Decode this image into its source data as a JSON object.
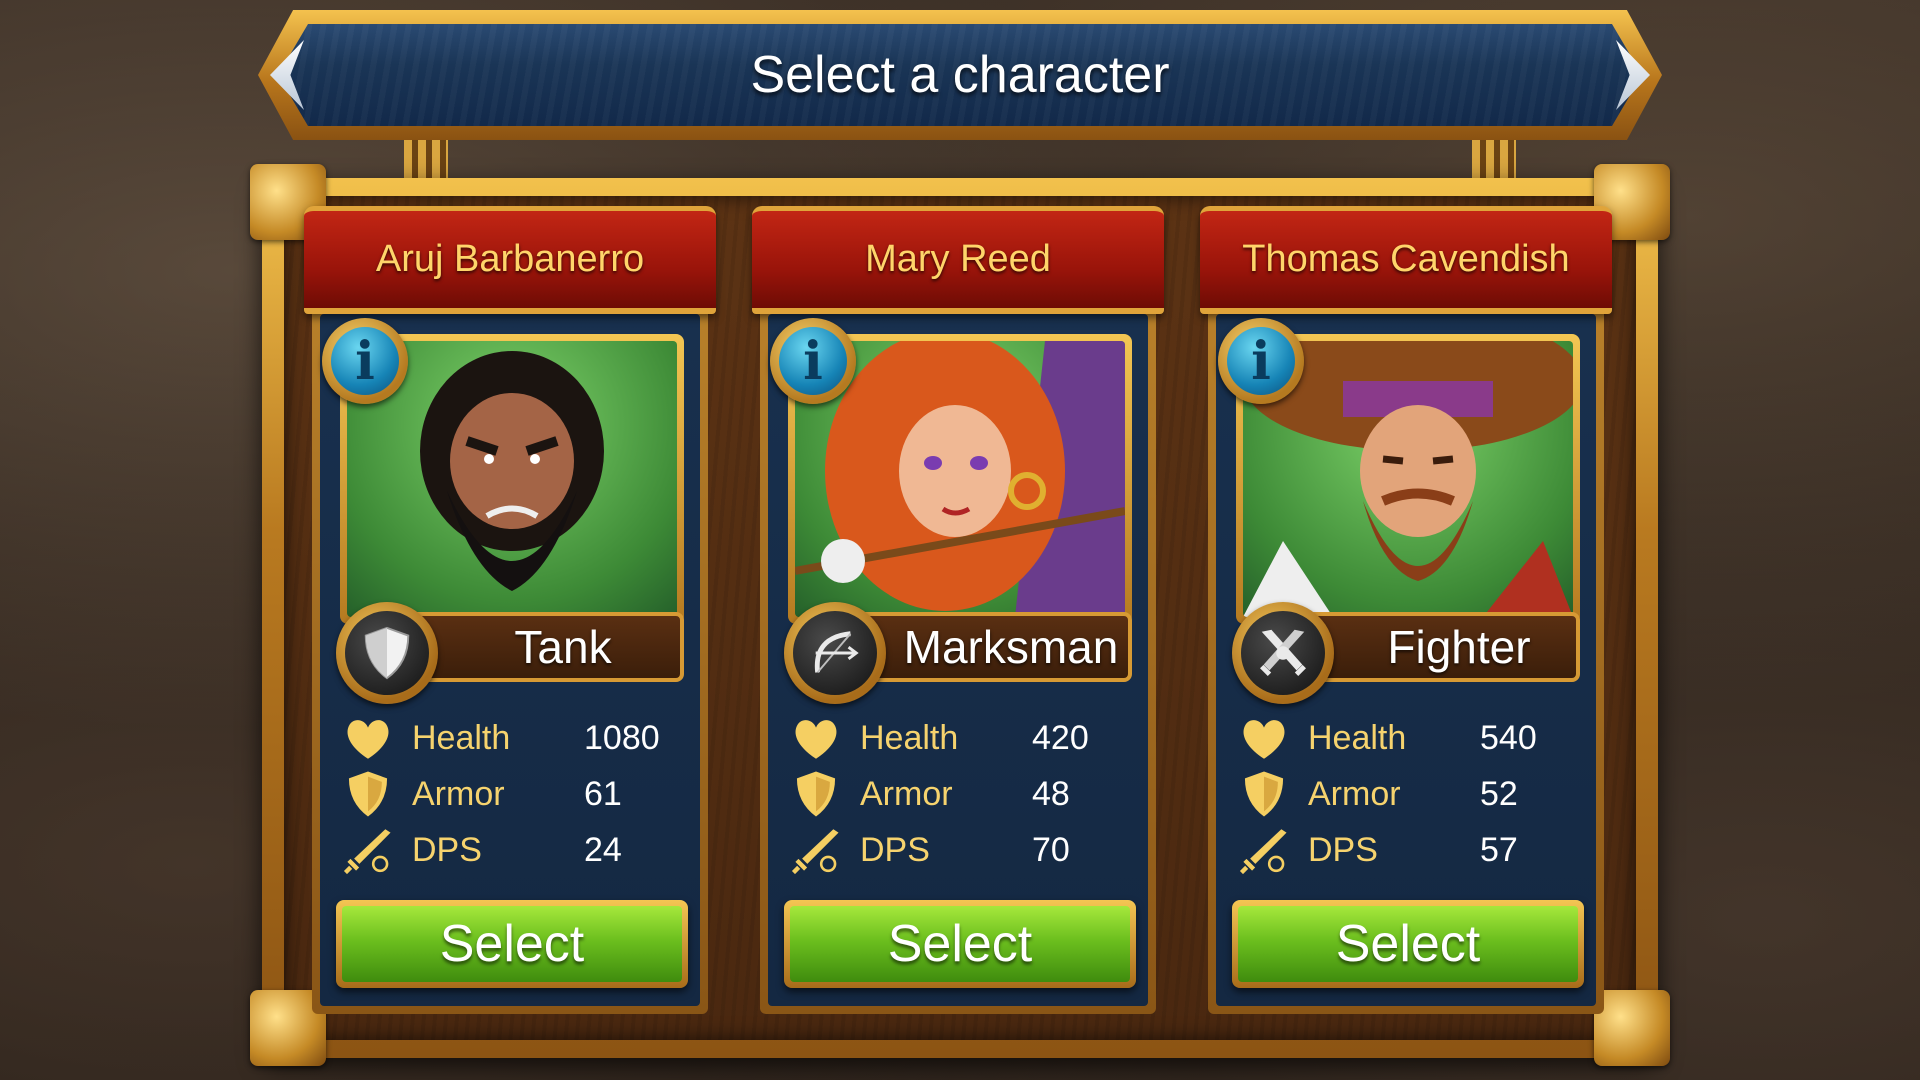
{
  "title": "Select a character",
  "characters": [
    {
      "name": "Aruj Barbanerro",
      "role": "Tank",
      "role_icon": "shield-icon",
      "portrait": "bearded-pirate-portrait",
      "stats": [
        {
          "label": "Health",
          "value": "1080",
          "icon": "heart-icon"
        },
        {
          "label": "Armor",
          "value": "61",
          "icon": "armor-shield-icon"
        },
        {
          "label": "DPS",
          "value": "24",
          "icon": "sword-icon"
        }
      ],
      "select_label": "Select"
    },
    {
      "name": "Mary Reed",
      "role": "Marksman",
      "role_icon": "bow-icon",
      "portrait": "red-haired-archer-portrait",
      "stats": [
        {
          "label": "Health",
          "value": "420",
          "icon": "heart-icon"
        },
        {
          "label": "Armor",
          "value": "48",
          "icon": "armor-shield-icon"
        },
        {
          "label": "DPS",
          "value": "70",
          "icon": "sword-icon"
        }
      ],
      "select_label": "Select"
    },
    {
      "name": "Thomas Cavendish",
      "role": "Fighter",
      "role_icon": "crossed-swords-icon",
      "portrait": "captain-hat-portrait",
      "stats": [
        {
          "label": "Health",
          "value": "540",
          "icon": "heart-icon"
        },
        {
          "label": "Armor",
          "value": "52",
          "icon": "armor-shield-icon"
        },
        {
          "label": "DPS",
          "value": "57",
          "icon": "sword-icon"
        }
      ],
      "select_label": "Select"
    }
  ],
  "info_label": "i",
  "colors": {
    "gold": "#f3c653",
    "ribbon_red": "#b01c0e",
    "name_gold": "#ffd56a",
    "card_navy": "#16304e",
    "select_green": "#6cbf1e"
  }
}
